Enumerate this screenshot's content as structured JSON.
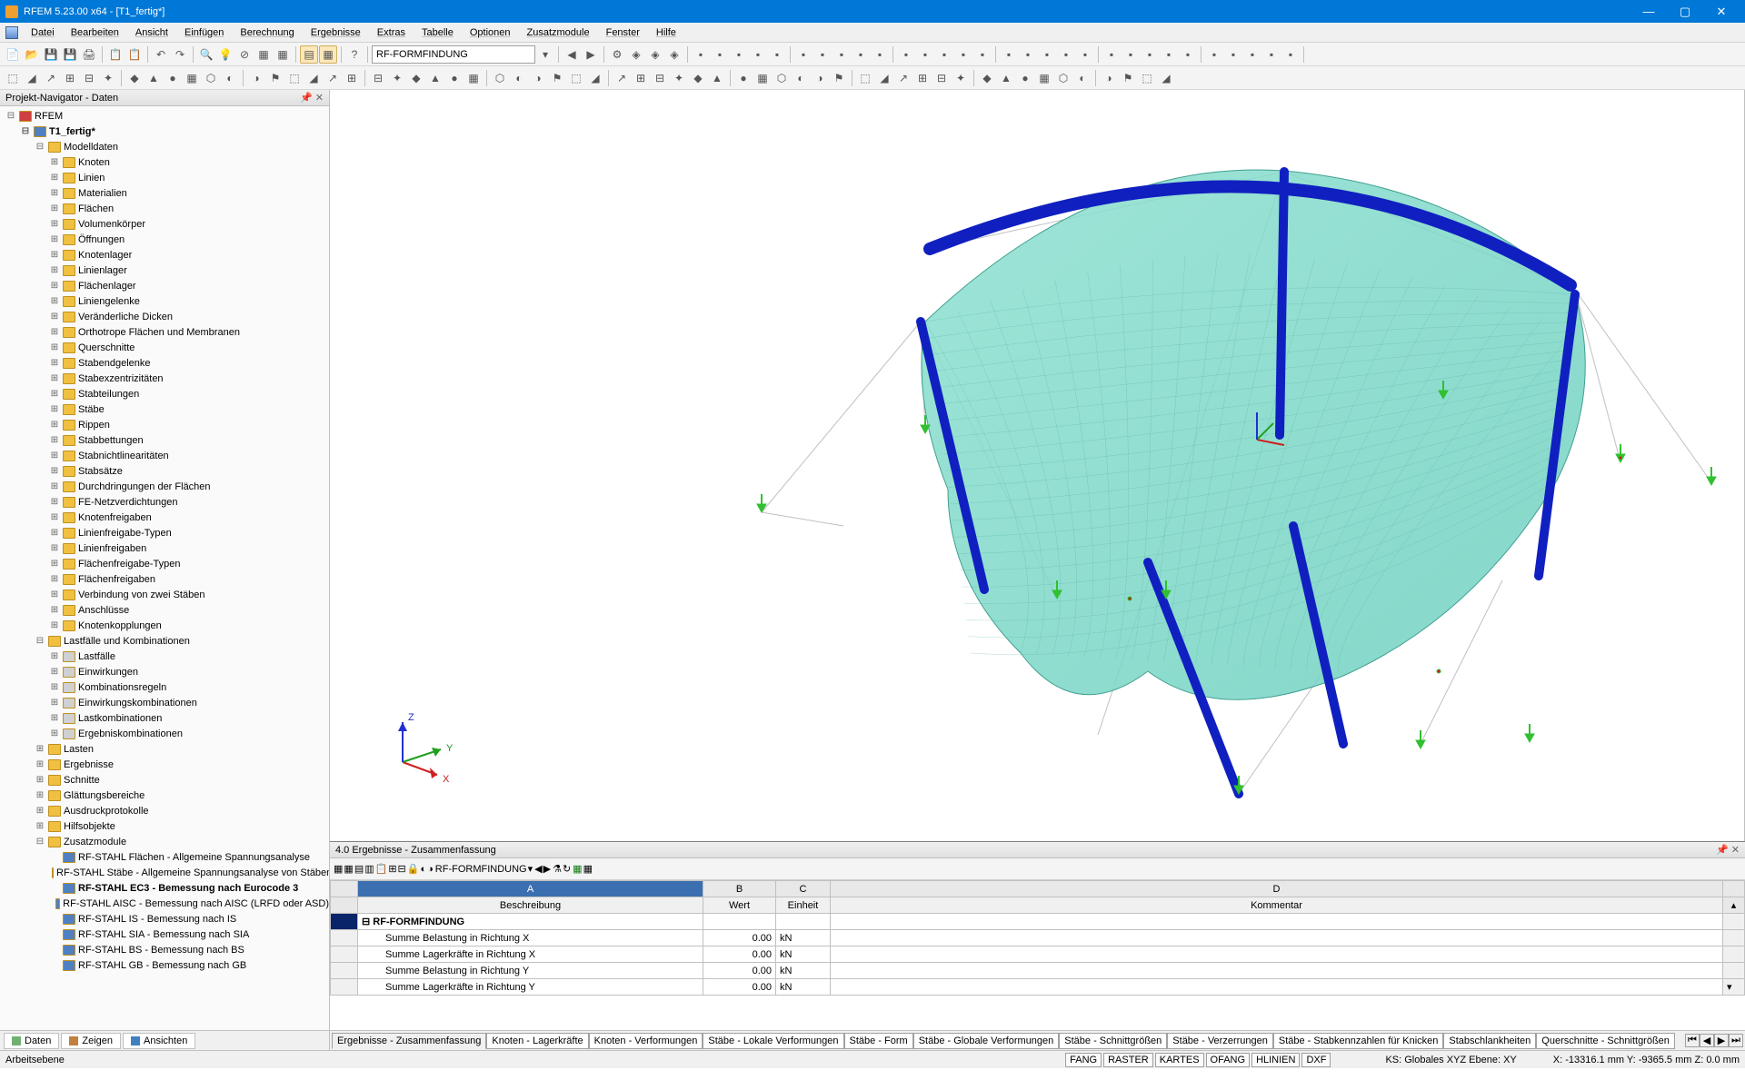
{
  "window": {
    "title": "RFEM 5.23.00 x64 - [T1_fertig*]"
  },
  "menu": [
    "Datei",
    "Bearbeiten",
    "Ansicht",
    "Einfügen",
    "Berechnung",
    "Ergebnisse",
    "Extras",
    "Tabelle",
    "Optionen",
    "Zusatzmodule",
    "Fenster",
    "Hilfe"
  ],
  "toolbar1": {
    "combo": "RF-FORMFINDUNG"
  },
  "navigator": {
    "title": "Projekt-Navigator - Daten",
    "root": "RFEM",
    "model": "T1_fertig*",
    "groups": {
      "modell": {
        "label": "Modelldaten",
        "items": [
          "Knoten",
          "Linien",
          "Materialien",
          "Flächen",
          "Volumenkörper",
          "Öffnungen",
          "Knotenlager",
          "Linienlager",
          "Flächenlager",
          "Liniengelenke",
          "Veränderliche Dicken",
          "Orthotrope Flächen und Membranen",
          "Querschnitte",
          "Stabendgelenke",
          "Stabexzentrizitäten",
          "Stabteilungen",
          "Stäbe",
          "Rippen",
          "Stabbettungen",
          "Stabnichtlinearitäten",
          "Stabsätze",
          "Durchdringungen der Flächen",
          "FE-Netzverdichtungen",
          "Knotenfreigaben",
          "Linienfreigabe-Typen",
          "Linienfreigaben",
          "Flächenfreigabe-Typen",
          "Flächenfreigaben",
          "Verbindung von zwei Stäben",
          "Anschlüsse",
          "Knotenkopplungen"
        ]
      },
      "lastf": {
        "label": "Lastfälle und Kombinationen",
        "items": [
          "Lastfälle",
          "Einwirkungen",
          "Kombinationsregeln",
          "Einwirkungskombinationen",
          "Lastkombinationen",
          "Ergebniskombinationen"
        ]
      },
      "other": [
        "Lasten",
        "Ergebnisse",
        "Schnitte",
        "Glättungsbereiche",
        "Ausdruckprotokolle",
        "Hilfsobjekte"
      ],
      "zusatz": {
        "label": "Zusatzmodule",
        "items": [
          "RF-STAHL Flächen - Allgemeine Spannungsanalyse",
          "RF-STAHL Stäbe - Allgemeine Spannungsanalyse von Stäben",
          "RF-STAHL EC3 - Bemessung nach Eurocode 3",
          "RF-STAHL AISC - Bemessung nach AISC (LRFD oder ASD)",
          "RF-STAHL IS - Bemessung nach IS",
          "RF-STAHL SIA - Bemessung nach SIA",
          "RF-STAHL BS - Bemessung nach BS",
          "RF-STAHL GB - Bemessung nach GB"
        ],
        "selected": 2
      }
    },
    "tabs": [
      "Daten",
      "Zeigen",
      "Ansichten"
    ]
  },
  "results": {
    "title": "4.0 Ergebnisse - Zusammenfassung",
    "combo": "RF-FORMFINDUNG",
    "columns_letters": [
      "A",
      "B",
      "C",
      "D"
    ],
    "columns": [
      "Beschreibung",
      "Wert",
      "Einheit",
      "Kommentar"
    ],
    "section": "RF-FORMFINDUNG",
    "rows": [
      {
        "desc": "Summe Belastung in Richtung X",
        "val": "0.00",
        "unit": "kN"
      },
      {
        "desc": "Summe Lagerkräfte in Richtung X",
        "val": "0.00",
        "unit": "kN"
      },
      {
        "desc": "Summe Belastung in Richtung Y",
        "val": "0.00",
        "unit": "kN"
      },
      {
        "desc": "Summe Lagerkräfte in Richtung Y",
        "val": "0.00",
        "unit": "kN"
      }
    ],
    "tabs": [
      "Ergebnisse - Zusammenfassung",
      "Knoten - Lagerkräfte",
      "Knoten - Verformungen",
      "Stäbe - Lokale Verformungen",
      "Stäbe - Form",
      "Stäbe - Globale Verformungen",
      "Stäbe - Schnittgrößen",
      "Stäbe - Verzerrungen",
      "Stäbe - Stabkennzahlen für Knicken",
      "Stabschlankheiten",
      "Querschnitte - Schnittgrößen"
    ]
  },
  "status": {
    "left": "Arbeitsebene",
    "snap": [
      "FANG",
      "RASTER",
      "KARTES",
      "OFANG",
      "HLINIEN",
      "DXF"
    ],
    "ks": "KS: Globales XYZ  Ebene: XY",
    "coord": "X: -13316.1 mm  Y: -9365.5 mm  Z: 0.0 mm"
  }
}
